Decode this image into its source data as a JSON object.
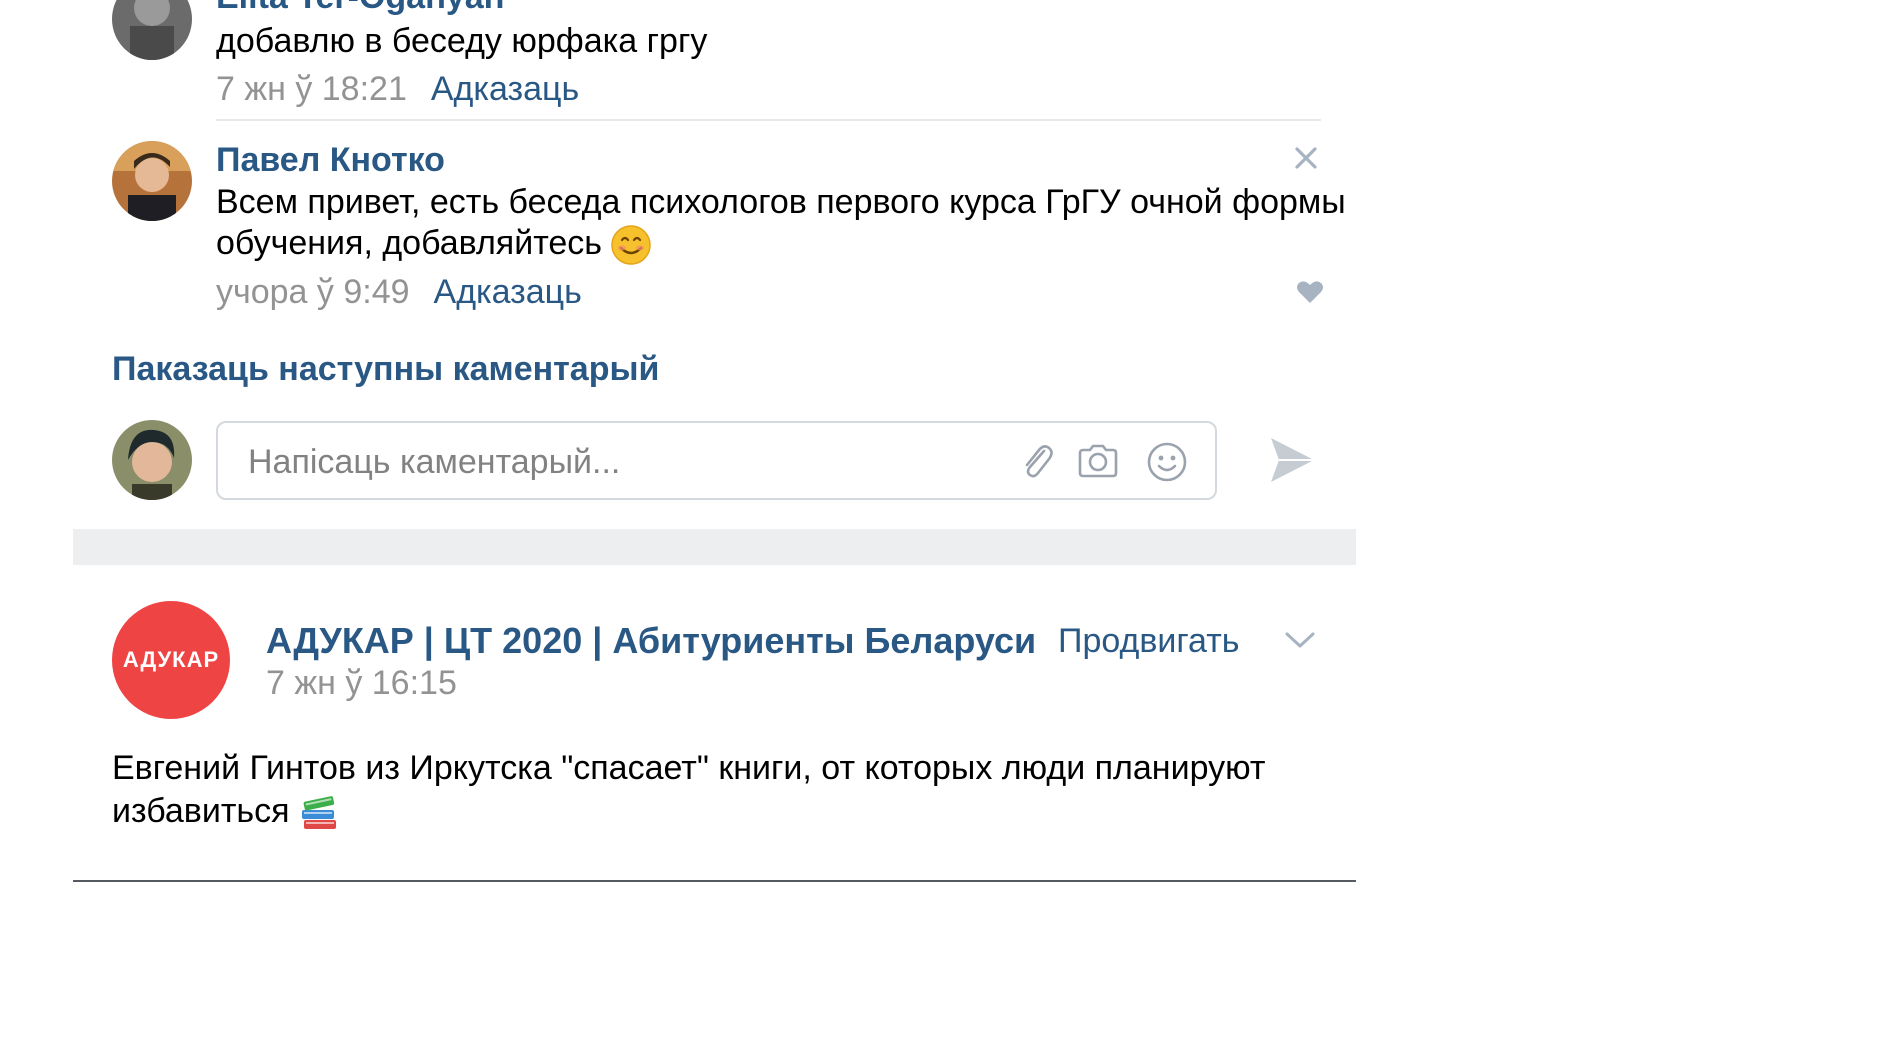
{
  "comments": [
    {
      "author": "Elita Ter-Oganyan",
      "text": "добавлю в беседу юрфака гргу",
      "date": "7 жн ў 18:21",
      "reply_label": "Адказаць"
    },
    {
      "author": "Павел Кнотко",
      "text_line1": "Всем привет, есть беседа психологов первого курса ГрГУ очной формы",
      "text_line2": "обучения, добавляйтесь",
      "date": "учора ў 9:49",
      "reply_label": "Адказаць"
    }
  ],
  "show_more_label": "Паказаць наступны каментарый",
  "comment_input": {
    "placeholder": "Напісаць каментарый..."
  },
  "post": {
    "group_logo_text": "АДУКАР",
    "group_name": "АДУКАР | ЦТ 2020 | Абитуриенты Беларуси",
    "date": "7 жн ў 16:15",
    "promote_label": "Продвигать",
    "text_line1": "Евгений Гинтов из Иркутска \"спасает\" книги, от которых люди планируют",
    "text_line2": "избавиться"
  },
  "colors": {
    "link": "#2a5885",
    "muted": "#939393",
    "logo_red": "#ef4444",
    "band": "#edeef0"
  },
  "icons": [
    "close-icon",
    "heart-icon",
    "paperclip-icon",
    "camera-icon",
    "smile-icon",
    "send-icon",
    "chevron-down-icon",
    "smiling-face-emoji",
    "books-emoji"
  ]
}
